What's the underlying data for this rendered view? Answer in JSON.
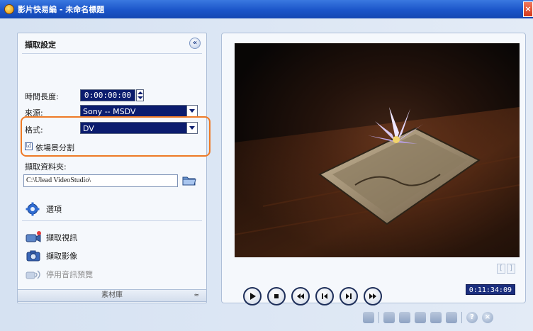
{
  "window": {
    "title": "影片快易編 - 未命名標題",
    "close_label": "×"
  },
  "capture_panel": {
    "title": "擷取設定",
    "collapse_label": "«",
    "duration_label": "時間長度:",
    "duration_value": "0:00:00:00",
    "source_label": "來源:",
    "source_value": "Sony -- MSDV",
    "format_label": "格式:",
    "format_value": "DV",
    "split_by_scene_label": "依場景分割",
    "split_by_scene_checked": "☑",
    "folder_label": "擷取資料夾:",
    "folder_value": "C:\\Ulead VideoStudio\\",
    "options_label": "選項",
    "capture_video_label": "擷取視訊",
    "capture_image_label": "擷取影像",
    "disable_audio_preview_label": "停用音訊預覽"
  },
  "library_bar": {
    "label": "素材庫",
    "arrow": "≈"
  },
  "preview": {
    "mark_in": "[",
    "mark_out": "]",
    "timecode": "0:11:34:09"
  },
  "icons": {
    "transport": [
      "play-icon",
      "stop-icon",
      "rewind-icon",
      "step-back-icon",
      "step-forward-icon",
      "fast-forward-icon"
    ]
  },
  "colors": {
    "title_bar": "#1b55c9",
    "dropdown_bg": "#0b1c6e",
    "highlight": "#ee7a26"
  }
}
